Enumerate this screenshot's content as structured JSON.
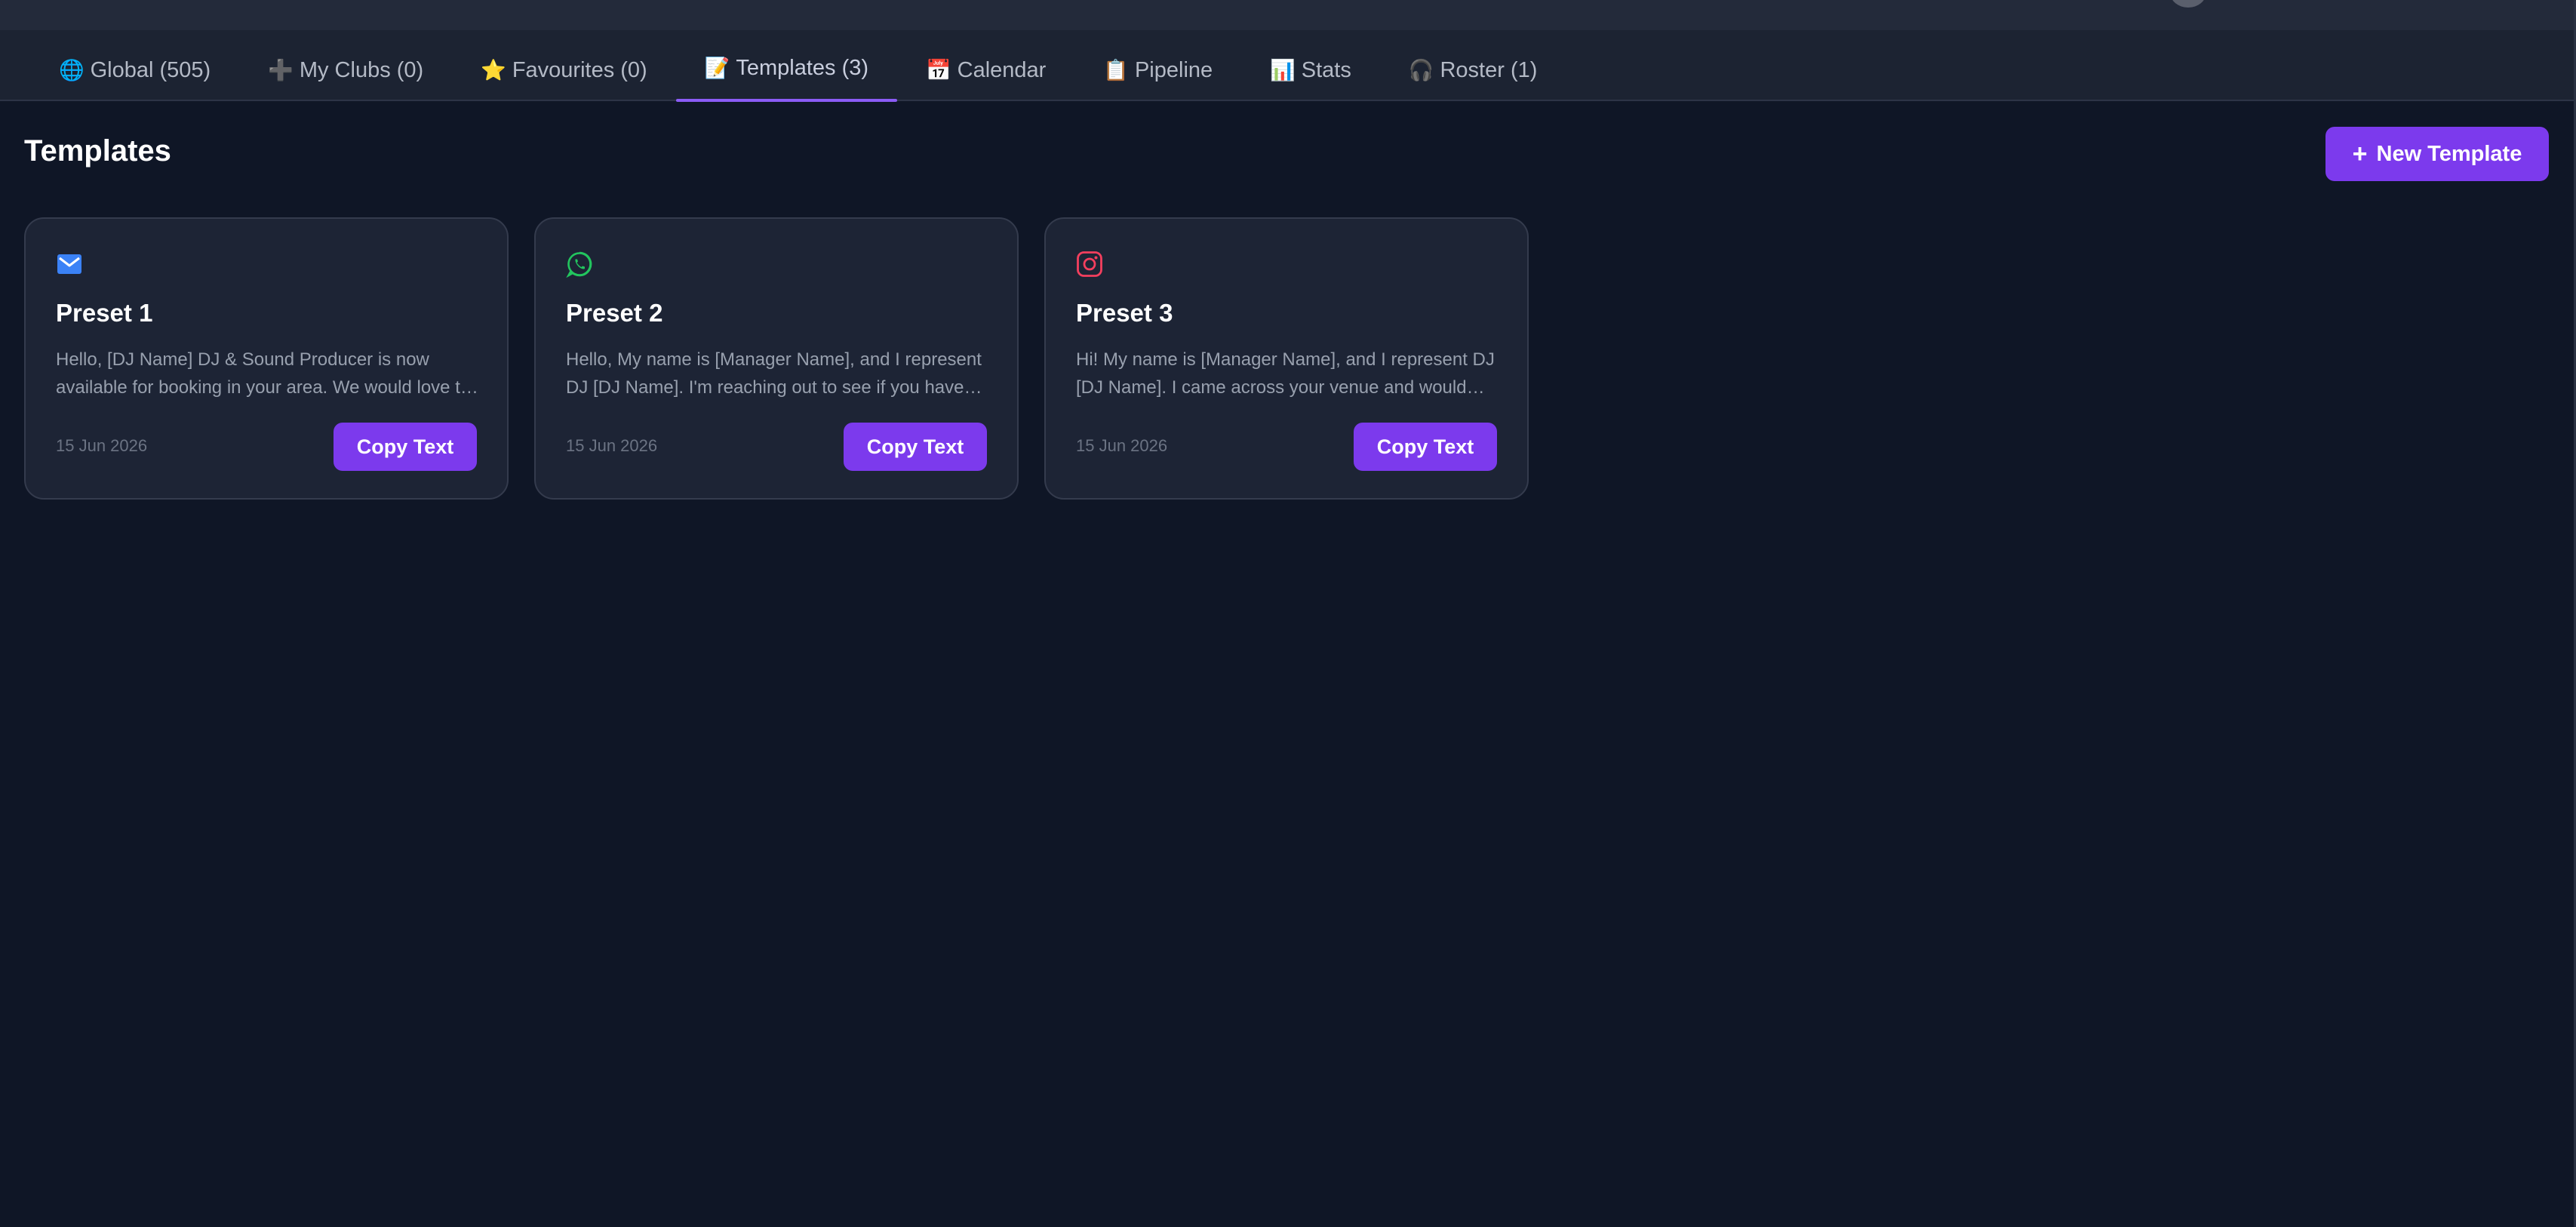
{
  "tabs": [
    {
      "icon": "globe-icon",
      "glyph": "🌐",
      "label": "Global (505)"
    },
    {
      "icon": "plus-icon",
      "glyph": "➕",
      "label": "My Clubs (0)"
    },
    {
      "icon": "star-icon",
      "glyph": "⭐",
      "label": "Favourites (0)"
    },
    {
      "icon": "memo-icon",
      "glyph": "📝",
      "label": "Templates (3)"
    },
    {
      "icon": "calendar-icon",
      "glyph": "📅",
      "label": "Calendar"
    },
    {
      "icon": "clipboard-icon",
      "glyph": "📋",
      "label": "Pipeline"
    },
    {
      "icon": "bar-chart-icon",
      "glyph": "📊",
      "label": "Stats"
    },
    {
      "icon": "headphones-icon",
      "glyph": "🎧",
      "label": "Roster (1)"
    }
  ],
  "active_tab": "Templates (3)",
  "page": {
    "title": "Templates",
    "new_button": {
      "plus": "+",
      "label": "New Template"
    }
  },
  "templates": [
    {
      "channel_icon": "email-icon",
      "channel_color": "#3b82f6",
      "name": "Preset 1",
      "preview": "Hello, [DJ Name] DJ & Sound Producer is now available for booking in your area. We would love to hear from you.",
      "date": "15 Jun 2026",
      "copy_label": "Copy Text"
    },
    {
      "channel_icon": "whatsapp-icon",
      "channel_color": "#22c55e",
      "name": "Preset 2",
      "preview": "Hello, My name is [Manager Name], and I represent DJ [DJ Name]. I'm reaching out to see if you have availability.",
      "date": "15 Jun 2026",
      "copy_label": "Copy Text"
    },
    {
      "channel_icon": "instagram-icon",
      "channel_color": "#f43f5e",
      "name": "Preset 3",
      "preview": "Hi! My name is [Manager Name], and I represent DJ [DJ Name]. I came across your venue and would love to connect.",
      "date": "15 Jun 2026",
      "copy_label": "Copy Text"
    }
  ],
  "colors": {
    "accent": "#7c3aed",
    "tab_underline": "#8b5cf6",
    "background": "#0f1626",
    "card": "#1d2435"
  }
}
